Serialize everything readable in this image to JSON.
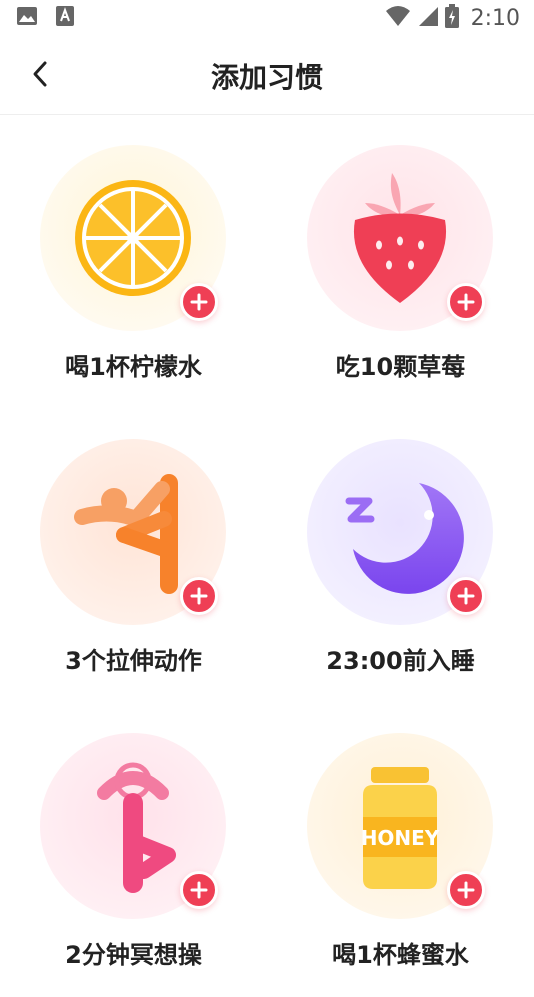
{
  "status_bar": {
    "time": "2:10",
    "left_icons": [
      "image-icon",
      "text-a-icon"
    ],
    "right_icons": [
      "wifi-icon",
      "signal-icon",
      "battery-icon"
    ]
  },
  "header": {
    "title": "添加习惯",
    "back_icon": "chevron-left-icon"
  },
  "colors": {
    "accent": "#ef3f55",
    "lemon": "#fbbd1c",
    "strawberry": "#ef3f55",
    "stretch": "#f7822b",
    "moon": "#8a52f0",
    "yoga": "#ef4a80",
    "honey": "#f9c233"
  },
  "habits": [
    {
      "label": "喝1杯柠檬水",
      "icon": "lemon-icon"
    },
    {
      "label": "吃10颗草莓",
      "icon": "strawberry-icon"
    },
    {
      "label": "3个拉伸动作",
      "icon": "stretch-icon"
    },
    {
      "label": "23:00前入睡",
      "icon": "moon-icon"
    },
    {
      "label": "2分钟冥想操",
      "icon": "yoga-icon"
    },
    {
      "label": "喝1杯蜂蜜水",
      "icon": "honey-jar-icon",
      "icon_text": "HONEY"
    }
  ]
}
